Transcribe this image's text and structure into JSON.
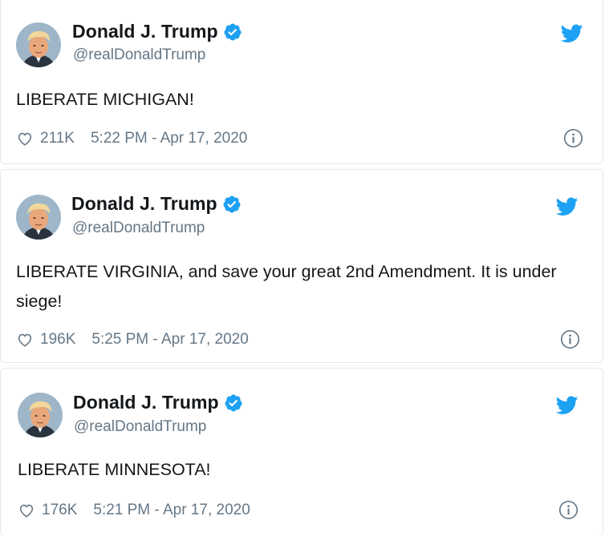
{
  "author": {
    "name": "Donald J. Trump",
    "handle": "@realDonaldTrump",
    "verified": true
  },
  "tweets": [
    {
      "text": "LIBERATE MICHIGAN!",
      "likes": "211K",
      "timestamp": "5:22 PM - Apr 17, 2020"
    },
    {
      "text": "LIBERATE VIRGINIA, and save your great 2nd Amendment. It is under siege!",
      "likes": "196K",
      "timestamp": "5:25 PM - Apr 17, 2020"
    },
    {
      "text": "LIBERATE MINNESOTA!",
      "likes": "176K",
      "timestamp": "5:21 PM - Apr 17, 2020"
    }
  ],
  "icons": {
    "bird": "twitter-bird-icon",
    "verified": "verified-badge-icon",
    "like": "heart-icon",
    "info": "info-icon"
  },
  "colors": {
    "twitter_blue": "#1da1f2",
    "text": "#14171a",
    "secondary": "#657786",
    "border": "#e1e8ed"
  }
}
